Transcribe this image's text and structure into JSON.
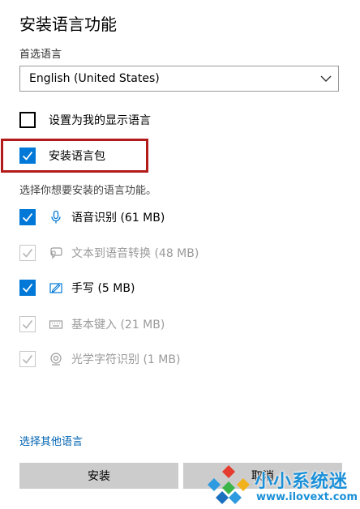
{
  "header": {
    "title": "安装语言功能"
  },
  "preferred_language": {
    "label": "首选语言",
    "selected": "English (United States)"
  },
  "options": {
    "display_language": {
      "label": "设置为我的显示语言",
      "checked": false
    },
    "language_pack": {
      "label": "安装语言包",
      "checked": true
    }
  },
  "features": {
    "hint": "选择你想要安装的语言功能。",
    "items": [
      {
        "label": "语音识别 (61 MB)",
        "icon": "microphone-icon",
        "checked": true,
        "enabled": true
      },
      {
        "label": "文本到语音转换 (48 MB)",
        "icon": "speech-bubble-icon",
        "checked": true,
        "enabled": false
      },
      {
        "label": "手写 (5 MB)",
        "icon": "pen-icon",
        "checked": true,
        "enabled": true
      },
      {
        "label": "基本键入 (21 MB)",
        "icon": "keyboard-icon",
        "checked": true,
        "enabled": false
      },
      {
        "label": "光学字符识别 (1 MB)",
        "icon": "ocr-icon",
        "checked": true,
        "enabled": false
      }
    ]
  },
  "footer": {
    "other_language_link": "选择其他语言",
    "install_label": "安装",
    "cancel_label": "取消"
  },
  "watermark": {
    "name": "小小系统迷",
    "url": "www.ilovext.com"
  },
  "colors": {
    "accent": "#0078d7",
    "highlight": "#b31b1b",
    "link": "#0063b1",
    "button": "#cccccc"
  }
}
